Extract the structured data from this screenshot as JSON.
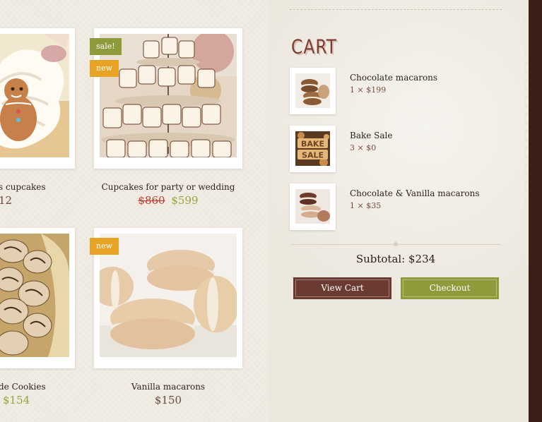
{
  "products": [
    {
      "name": "s cupcakes",
      "price": "12"
    },
    {
      "name": "Cupcakes for party or wedding",
      "old_price": "$860",
      "price": "$599",
      "badges": [
        "sale!",
        "new"
      ]
    },
    {
      "name": "de Cookies",
      "price": "$154"
    },
    {
      "name": "Vanilla macarons",
      "price": "$150",
      "badges": [
        "new"
      ]
    }
  ],
  "cart": {
    "title": "CART",
    "items": [
      {
        "name": "Chocolate macarons",
        "qty": "1 × $199"
      },
      {
        "name": "Bake Sale",
        "qty": "3 × $0",
        "thumb_text_1": "BAKE",
        "thumb_text_2": "SALE"
      },
      {
        "name": "Chocolate & Vanilla macarons",
        "qty": "1 × $35"
      }
    ],
    "subtotal": "Subtotal: $234",
    "view_cart_label": "View Cart",
    "checkout_label": "Checkout"
  },
  "colors": {
    "accent_brown": "#6b3b32",
    "accent_olive": "#8f9a3b",
    "badge_new": "#e7a424",
    "sale_red": "#c0392b"
  }
}
